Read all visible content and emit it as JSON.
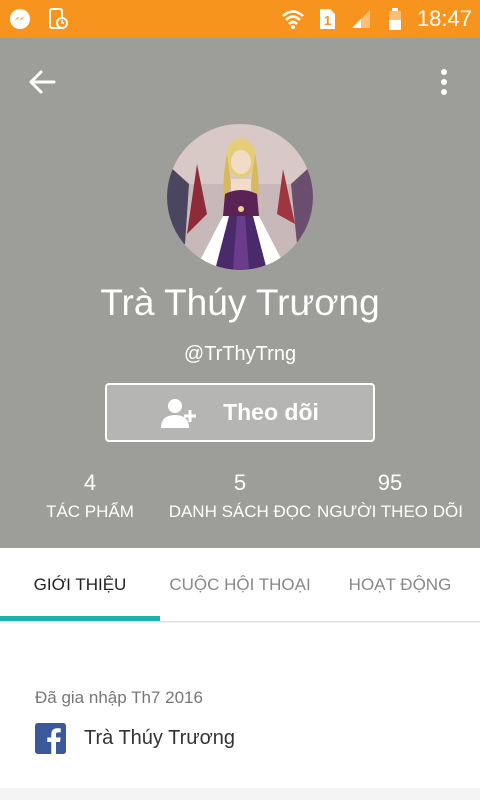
{
  "status_bar": {
    "time": "18:47",
    "sim_label": "1",
    "icons": [
      "messenger-icon",
      "sim-toolkit-icon",
      "wifi-icon",
      "sim-icon",
      "signal-icon",
      "battery-icon"
    ]
  },
  "profile": {
    "name": "Trà Thúy Trương",
    "handle": "@TrThyTrng",
    "follow_label": "Theo dõi"
  },
  "stats": [
    {
      "value": "4",
      "label": "TÁC PHẨM"
    },
    {
      "value": "5",
      "label": "DANH SÁCH ĐỌC"
    },
    {
      "value": "95",
      "label": "NGƯỜI THEO DÕI"
    }
  ],
  "tabs": [
    {
      "label": "GIỚI THIỆU",
      "active": true
    },
    {
      "label": "CUỘC HỘI THOẠI",
      "active": false
    },
    {
      "label": "HOẠT ĐỘNG",
      "active": false
    }
  ],
  "about": {
    "joined": "Đã gia nhập Th7 2016",
    "facebook_name": "Trà Thúy Trương"
  },
  "colors": {
    "status_bar": "#f7941d",
    "header": "#9d9d9a",
    "tab_indicator": "#1eb1a9",
    "facebook": "#3b5998"
  }
}
